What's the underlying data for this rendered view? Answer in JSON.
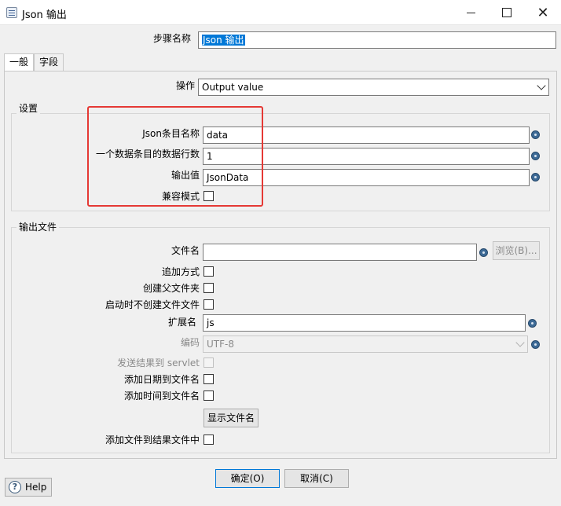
{
  "window": {
    "title": "Json 输出"
  },
  "step_name": {
    "label": "步骤名称",
    "value": "Json 输出"
  },
  "tabs": [
    {
      "label": "一般"
    },
    {
      "label": "字段"
    }
  ],
  "operation": {
    "label": "操作",
    "value": "Output value"
  },
  "settings": {
    "title": "设置",
    "json_block_name": {
      "label": "Json条目名称",
      "value": "data"
    },
    "rows_per_block": {
      "label": "一个数据条目的数据行数",
      "value": "1"
    },
    "output_value": {
      "label": "输出值",
      "value": "JsonData"
    },
    "compat_mode": {
      "label": "兼容模式"
    }
  },
  "output_file": {
    "title": "输出文件",
    "filename": {
      "label": "文件名",
      "value": ""
    },
    "browse_button": "浏览(B)...",
    "append": {
      "label": "追加方式"
    },
    "create_parent": {
      "label": "创建父文件夹"
    },
    "no_create_at_start": {
      "label": "启动时不创建文件文件"
    },
    "extension": {
      "label": "扩展名",
      "value": "js"
    },
    "encoding": {
      "label": "编码",
      "value": "UTF-8"
    },
    "send_to_servlet": {
      "label": "发送结果到 servlet"
    },
    "add_date": {
      "label": "添加日期到文件名"
    },
    "add_time": {
      "label": "添加时间到文件名"
    },
    "show_filename_button": "显示文件名",
    "add_to_result": {
      "label": "添加文件到结果文件中"
    }
  },
  "footer": {
    "help": "Help",
    "ok": "确定(O)",
    "cancel": "取消(C)"
  },
  "colors": {
    "highlight_border": "#e53935",
    "selection": "#0078d7"
  }
}
